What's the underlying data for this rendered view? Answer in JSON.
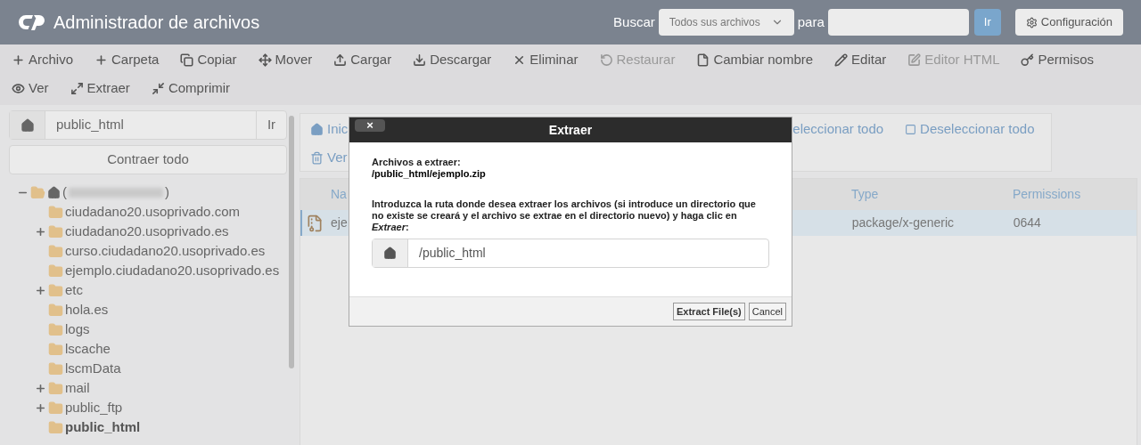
{
  "header": {
    "title": "Administrador de archivos",
    "search_label": "Buscar",
    "search_scope": "Todos sus archivos",
    "for_label": "para",
    "search_button": "Ir",
    "settings_button": "Configuración"
  },
  "toolbar": [
    [
      {
        "kind": "plus",
        "label": "Archivo",
        "disabled": false
      },
      {
        "kind": "plus",
        "label": "Carpeta",
        "disabled": false
      },
      {
        "kind": "copy",
        "label": "Copiar",
        "disabled": false
      },
      {
        "kind": "move",
        "label": "Mover",
        "disabled": false
      },
      {
        "kind": "upload",
        "label": "Cargar",
        "disabled": false
      },
      {
        "kind": "download",
        "label": "Descargar",
        "disabled": false
      },
      {
        "kind": "delete",
        "label": "Eliminar",
        "disabled": false
      },
      {
        "kind": "restore",
        "label": "Restaurar",
        "disabled": true
      },
      {
        "kind": "rename",
        "label": "Cambiar nombre",
        "disabled": false
      },
      {
        "kind": "edit",
        "label": "Editar",
        "disabled": false
      },
      {
        "kind": "html",
        "label": "Editor HTML",
        "disabled": true
      },
      {
        "kind": "key",
        "label": "Permisos",
        "disabled": false
      }
    ],
    [
      {
        "kind": "view",
        "label": "Ver",
        "disabled": false
      },
      {
        "kind": "extract",
        "label": "Extraer",
        "disabled": false
      },
      {
        "kind": "compress",
        "label": "Comprimir",
        "disabled": false
      }
    ]
  ],
  "sidebar": {
    "path": "public_html",
    "go_button": "Ir",
    "collapse_button": "Contraer todo",
    "tree": {
      "prefix": "(",
      "suffix": ")",
      "expanded": true,
      "children": [
        {
          "label": "ciudadano20.usoprivado.com",
          "expandable": false,
          "selected": false
        },
        {
          "label": "ciudadano20.usoprivado.es",
          "expandable": true,
          "selected": false
        },
        {
          "label": "curso.ciudadano20.usoprivado.es",
          "expandable": false,
          "selected": false
        },
        {
          "label": "ejemplo.ciudadano20.usoprivado.es",
          "expandable": false,
          "selected": false
        },
        {
          "label": "etc",
          "expandable": true,
          "selected": false
        },
        {
          "label": "hola.es",
          "expandable": false,
          "selected": false
        },
        {
          "label": "logs",
          "expandable": false,
          "selected": false
        },
        {
          "label": "lscache",
          "expandable": false,
          "selected": false
        },
        {
          "label": "lscmData",
          "expandable": false,
          "selected": false
        },
        {
          "label": "mail",
          "expandable": true,
          "selected": false
        },
        {
          "label": "public_ftp",
          "expandable": true,
          "selected": false
        },
        {
          "label": "public_html",
          "expandable": false,
          "selected": true
        }
      ]
    }
  },
  "files": {
    "home_link": "Inic",
    "select_all": "eleccionar todo",
    "deselect_all": "Deseleccionar todo",
    "trash_link": "Ver",
    "columns": [
      "Na",
      "Type",
      "Permissions"
    ],
    "rows": [
      {
        "name": "eje",
        "type": "package/x-generic",
        "permissions": "0644",
        "selected": true
      }
    ]
  },
  "dialog": {
    "close": "×",
    "title": "Extraer",
    "files_label": "Archivos a extraer:",
    "file_path": "/public_html/ejemplo.zip",
    "instructions": "Introduzca la ruta donde desea extraer los archivos (si introduce un directorio que no existe se creará y el archivo se extrae en el directorio nuevo) y haga clic en *Extraer*:",
    "path_value": "/public_html",
    "extract_button": "Extract File(s)",
    "cancel_button": "Cancel"
  }
}
